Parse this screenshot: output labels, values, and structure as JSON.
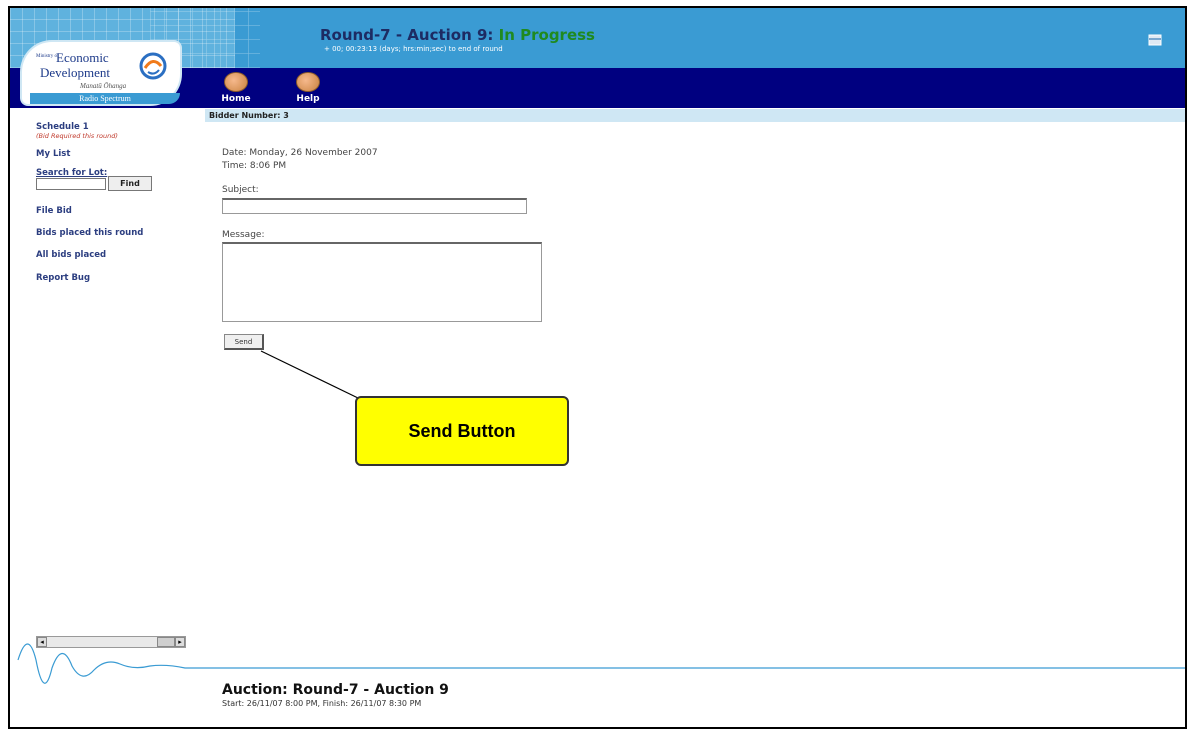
{
  "header": {
    "title_prefix": "Round-7 - Auction 9: ",
    "status": "In Progress",
    "countdown": "+ 00; 00:23:13 (days; hrs:min;sec) to end of round"
  },
  "logo": {
    "ministry": "Ministry of",
    "line1": "Economic",
    "line2": "Development",
    "maori": "Manatū Ōhanga",
    "bar": "Radio Spectrum"
  },
  "nav": {
    "items": [
      {
        "label": "Home",
        "icon": "home-button-icon"
      },
      {
        "label": "Help",
        "icon": "help-button-icon"
      }
    ]
  },
  "bidder": {
    "label": "Bidder Number: 3"
  },
  "sidebar": {
    "schedule": "Schedule 1",
    "schedule_note": "(Bid Required this round)",
    "my_list": "My List",
    "search_label": "Search for Lot:",
    "find_button": "Find",
    "file_bid": "File Bid",
    "bids_this_round": "Bids placed this round",
    "all_bids": "All bids placed",
    "report_bug": "Report Bug"
  },
  "main": {
    "date": "Date: Monday, 26 November 2007",
    "time": "Time: 8:06 PM",
    "subject_label": "Subject:",
    "subject_value": "",
    "message_label": "Message:",
    "message_value": "",
    "send_button": "Send"
  },
  "annotation": {
    "callout": "Send Button"
  },
  "footer": {
    "title": "Auction: Round-7 - Auction 9",
    "times": "Start: 26/11/07 8:00 PM, Finish: 26/11/07 8:30 PM"
  },
  "colors": {
    "header_blue": "#3a9bd3",
    "nav_navy": "#000080",
    "status_green": "#1f8a1f",
    "callout_yellow": "#ffff00"
  }
}
